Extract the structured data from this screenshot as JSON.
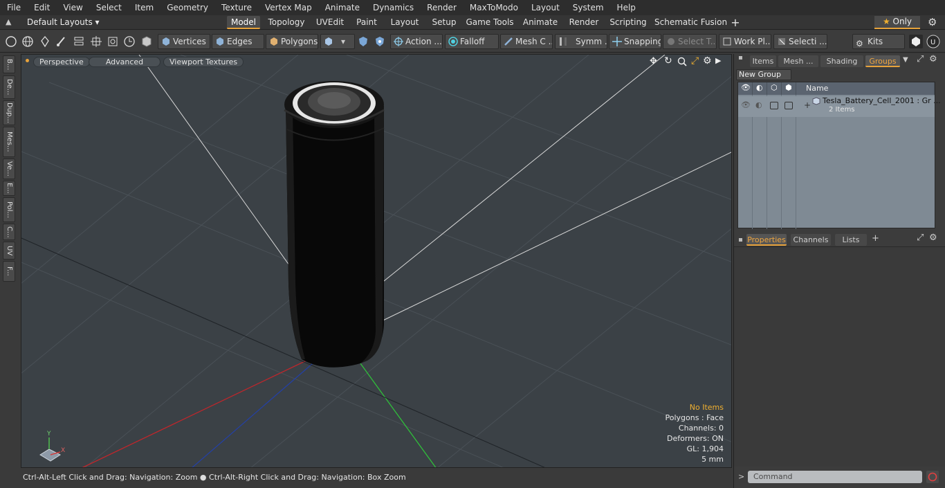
{
  "menu": [
    "File",
    "Edit",
    "View",
    "Select",
    "Item",
    "Geometry",
    "Texture",
    "Vertex Map",
    "Animate",
    "Dynamics",
    "Render",
    "MaxToModo",
    "Layout",
    "System",
    "Help"
  ],
  "layout_bar": {
    "layout_dropdown": "Default Layouts ▾",
    "tabs": [
      "Model",
      "Topology",
      "UVEdit",
      "Paint",
      "Layout",
      "Setup",
      "Game Tools",
      "Animate",
      "Render",
      "Scripting",
      "Schematic Fusion"
    ],
    "active_tab": "Model",
    "add_tab": "+",
    "only_label": "Only"
  },
  "toolbar": {
    "vertices": "Vertices",
    "edges": "Edges",
    "polygons": "Polygons",
    "action": "Action",
    "falloff": "Falloff",
    "mesh_c": "Mesh C ...",
    "symm": "Symm ...",
    "snapping": "Snapping",
    "select_t": "Select T...",
    "work_pl": "Work Pl...",
    "selecti": "Selecti ...",
    "kits": "Kits"
  },
  "left_tabs": [
    "B...",
    "De...",
    "Dup...",
    "Mes...",
    "Ve...",
    "E...",
    "Pol...",
    "C...",
    "UV",
    "F..."
  ],
  "viewport": {
    "perspective": "Perspective",
    "advanced": "Advanced",
    "textures": "Viewport Textures",
    "stats": {
      "no_items": "No Items",
      "polygons": "Polygons : Face",
      "channels": "Channels: 0",
      "deformers": "Deformers: ON",
      "gl": "GL: 1,904",
      "scale": "5 mm"
    },
    "axis_y": "Y",
    "axis_x": "X"
  },
  "status_bar": {
    "hint1": "Ctrl-Alt-Left Click and Drag: Navigation: Zoom",
    "hint2": "Ctrl-Alt-Right Click and Drag: Navigation: Box Zoom"
  },
  "right_panel": {
    "tabs": [
      "Items",
      "Mesh ...",
      "Shading",
      "Groups"
    ],
    "active_tab": "Groups",
    "new_group": "New Group",
    "name_header": "Name",
    "group_name": "Tesla_Battery_Cell_2001 : Gr ...",
    "group_count": "2 Items",
    "expand": "+",
    "prop_tabs": [
      "Properties",
      "Channels",
      "Lists"
    ],
    "active_prop_tab": "Properties",
    "add_tab": "+",
    "command_placeholder": "Command",
    "command_prompt": ">"
  },
  "colors": {
    "accent": "#e8a33b",
    "viewport_bg": "#3b4146",
    "x_axis": "#c0262b",
    "y_axis": "#2fbf3a",
    "z_axis": "#2340a8"
  }
}
